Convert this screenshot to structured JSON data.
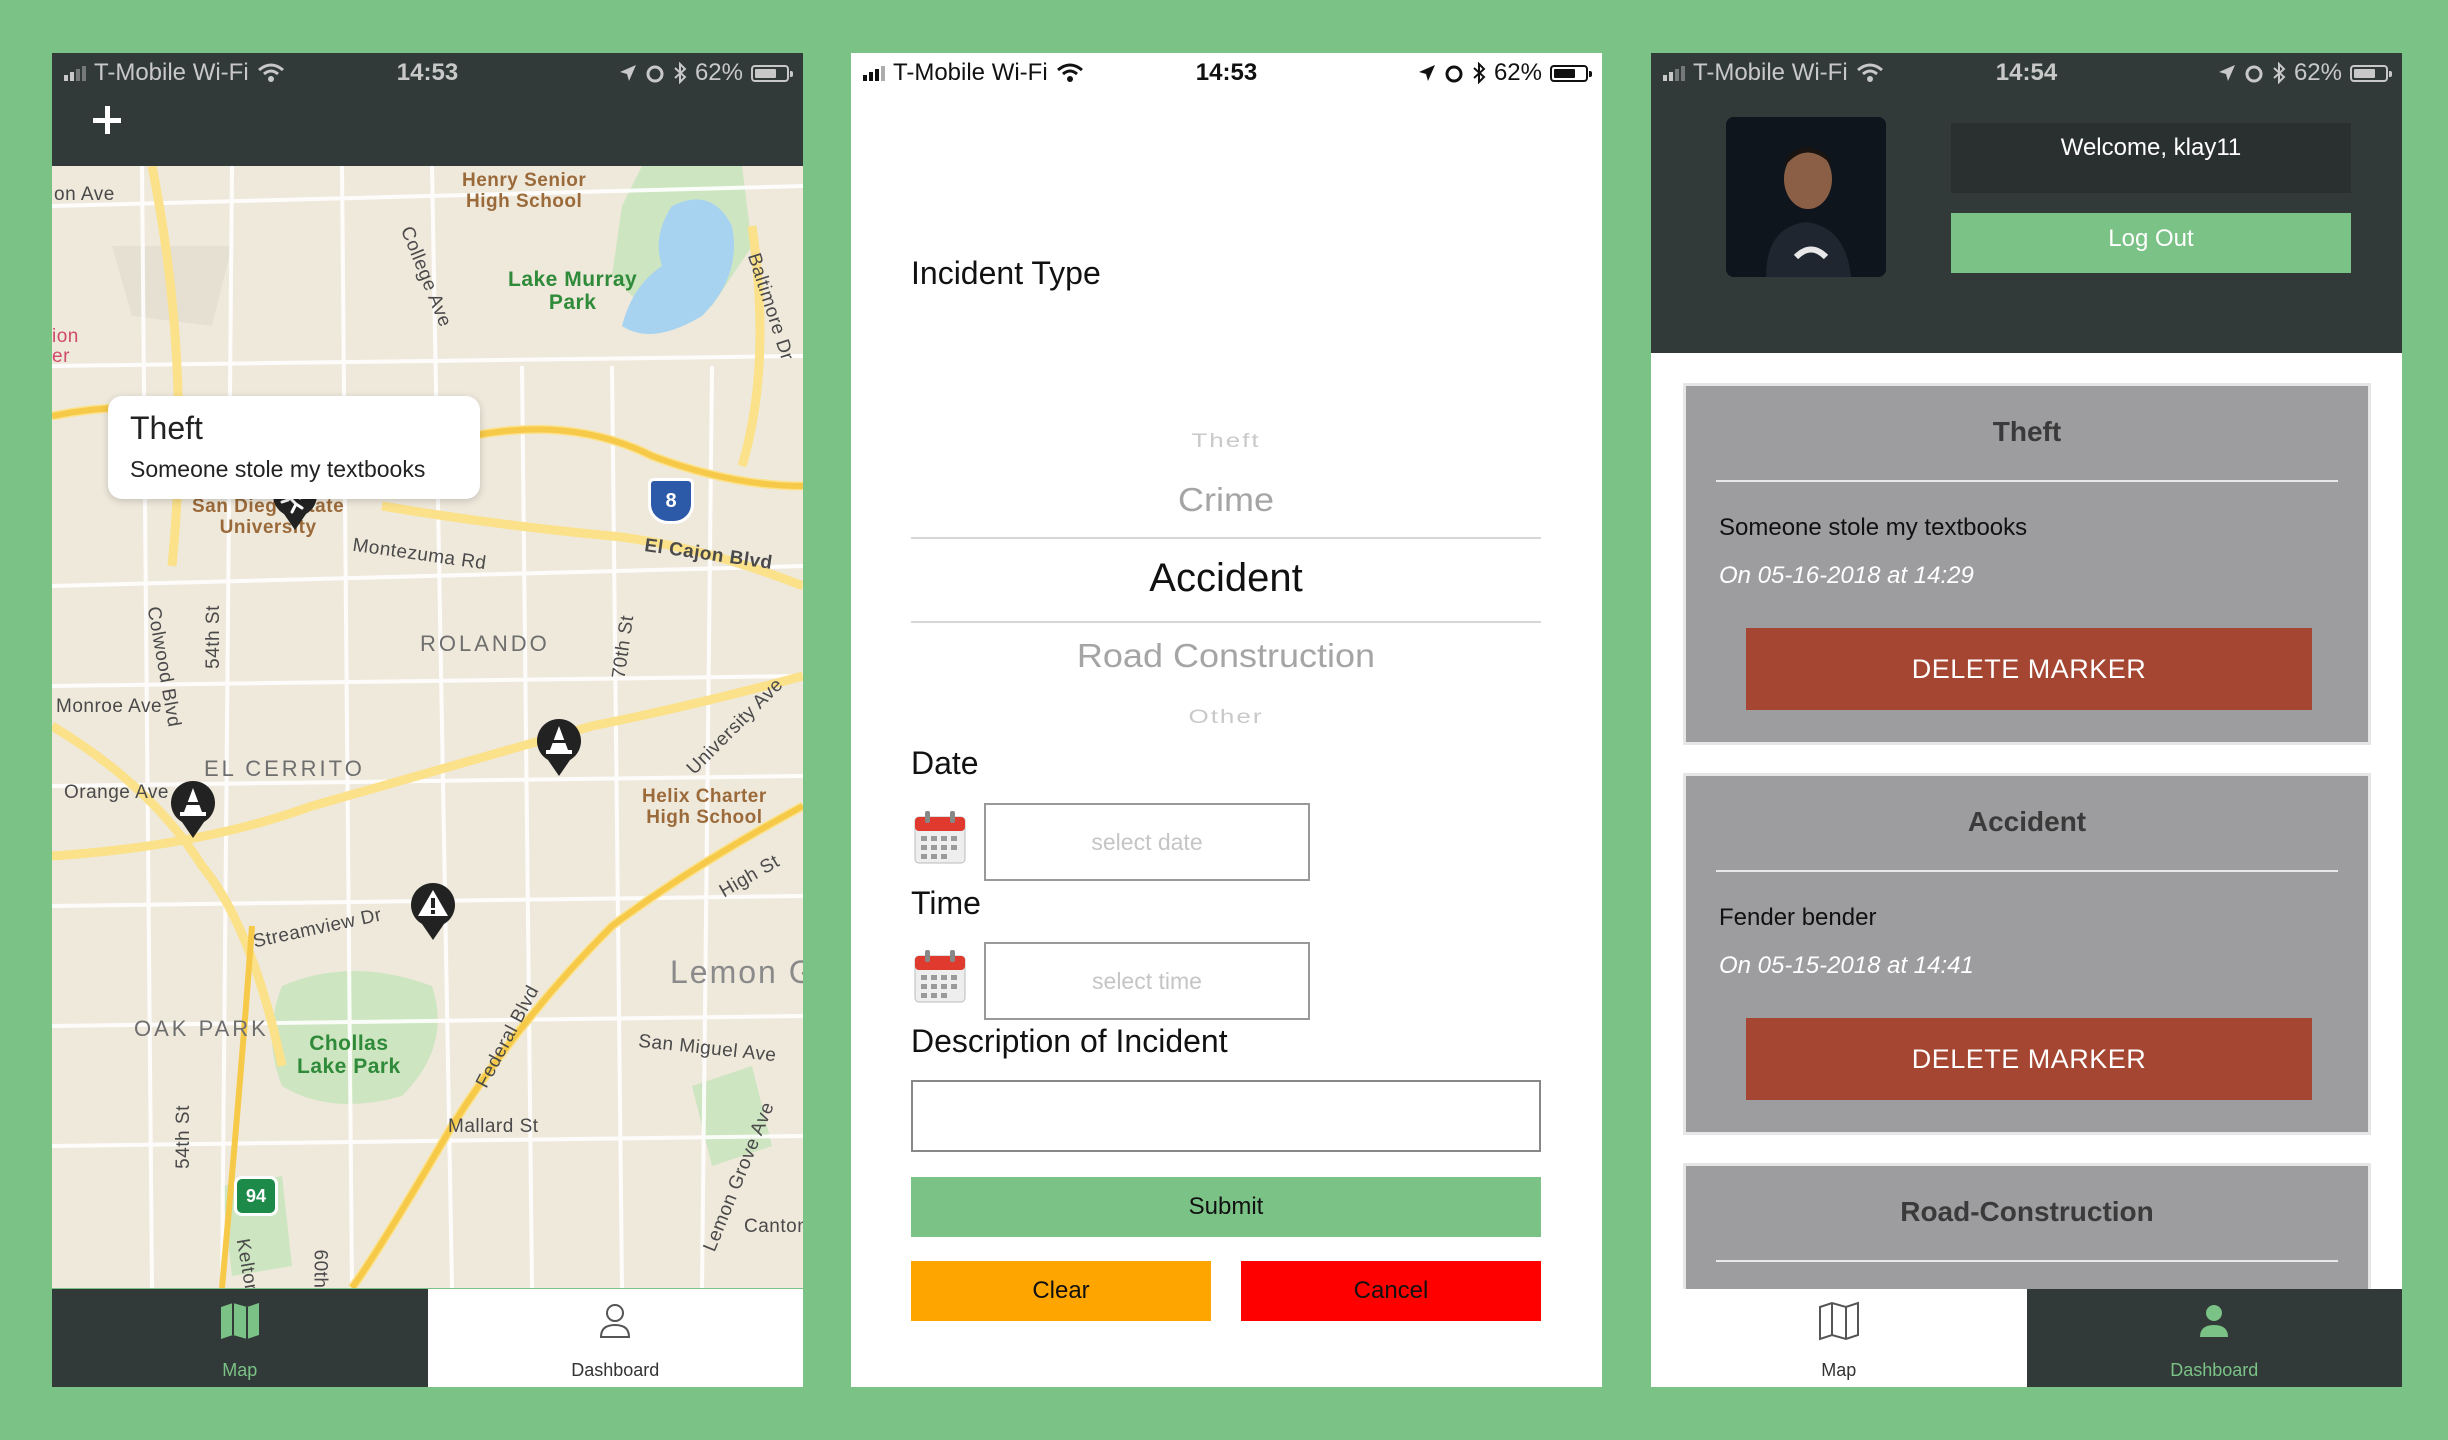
{
  "status": {
    "carrier": "T-Mobile Wi-Fi",
    "battery": "62%",
    "time1": "14:53",
    "time2": "14:53",
    "time3": "14:54"
  },
  "map_screen": {
    "callout": {
      "title": "Theft",
      "description": "Someone stole my textbooks"
    },
    "labels": {
      "on_ave": "on Ave",
      "ion": "ion",
      "er": "er",
      "henry": "Henry Senior",
      "henry2": "High School",
      "college": "College Ave",
      "lake1": "Lake Murray",
      "lake2": "Park",
      "baltimore": "Baltimore Dr",
      "sdsu1": "San Diego State",
      "sdsu2": "University",
      "montezuma": "Montezuma Rd",
      "interstate": "8",
      "elcajon": "El Cajon Blvd",
      "colwood": "Colwood Blvd",
      "st54": "54th St",
      "rolando": "ROLANDO",
      "st70": "70th St",
      "university": "University Ave",
      "monroe": "Monroe Ave",
      "elcerrito": "EL CERRITO",
      "helix1": "Helix Charter",
      "helix2": "High School",
      "orange": "Orange Ave",
      "highst": "High St",
      "streamview": "Streamview Dr",
      "lemon": "Lemon G",
      "oakpark": "OAK PARK",
      "chollas1": "Chollas",
      "chollas2": "Lake Park",
      "federal": "Federal Blvd",
      "sanmiguel": "San Miguel Ave",
      "st54b": "54th St",
      "mallard": "Mallard St",
      "lemongrove": "Lemon Grove Ave",
      "canton": "Canton",
      "route94": "94",
      "kelton": "Kelton",
      "st60": "60th"
    },
    "tabs": [
      {
        "label": "Map"
      },
      {
        "label": "Dashboard"
      }
    ]
  },
  "form_screen": {
    "incident_type_label": "Incident Type",
    "picker_options": [
      "Theft",
      "Crime",
      "Accident",
      "Road Construction",
      "Other"
    ],
    "selected_option": "Accident",
    "date_label": "Date",
    "date_placeholder": "select date",
    "time_label": "Time",
    "time_placeholder": "select time",
    "description_label": "Description of Incident",
    "submit_label": "Submit",
    "clear_label": "Clear",
    "cancel_label": "Cancel"
  },
  "dashboard_screen": {
    "welcome": "Welcome, klay11",
    "logout": "Log Out",
    "cards": [
      {
        "title": "Theft",
        "description": "Someone stole my textbooks",
        "date": "On 05-16-2018 at 14:29",
        "button": "DELETE MARKER"
      },
      {
        "title": "Accident",
        "description": "Fender bender",
        "date": "On 05-15-2018 at 14:41",
        "button": "DELETE MARKER"
      },
      {
        "title": "Road-Construction"
      }
    ],
    "tabs": [
      {
        "label": "Map"
      },
      {
        "label": "Dashboard"
      }
    ]
  },
  "colors": {
    "background": "#7bc286",
    "dark": "#323a39",
    "accent_green": "#7bc286",
    "delete_red": "#a54632",
    "clear_orange": "#ffa500",
    "cancel_red": "#ff0000",
    "card_gray": "#9d9d9f"
  }
}
